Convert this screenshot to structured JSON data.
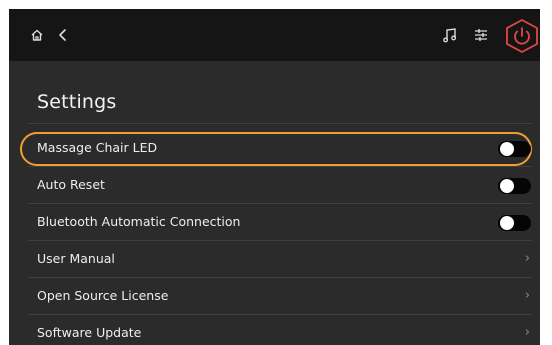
{
  "topbar": {
    "icons": [
      "home-icon",
      "back-icon",
      "music-note-icon",
      "equalizer-icon",
      "power-icon"
    ],
    "power_color": "#e04848"
  },
  "settings": {
    "title": "Settings",
    "items": [
      {
        "label": "Massage Chair LED",
        "control": "toggle",
        "on": false,
        "highlighted": true
      },
      {
        "label": "Auto Reset",
        "control": "toggle",
        "on": false
      },
      {
        "label": "Bluetooth Automatic Connection",
        "control": "toggle",
        "on": false
      },
      {
        "label": "User Manual",
        "control": "chevron",
        "chevron": "›"
      },
      {
        "label": "Open Source License",
        "control": "chevron",
        "chevron": "›"
      },
      {
        "label": "Software Update",
        "control": "chevron",
        "chevron": "›"
      }
    ]
  },
  "colors": {
    "highlight": "#f0a030",
    "background": "#2b2b2b",
    "topbar": "#151515"
  }
}
